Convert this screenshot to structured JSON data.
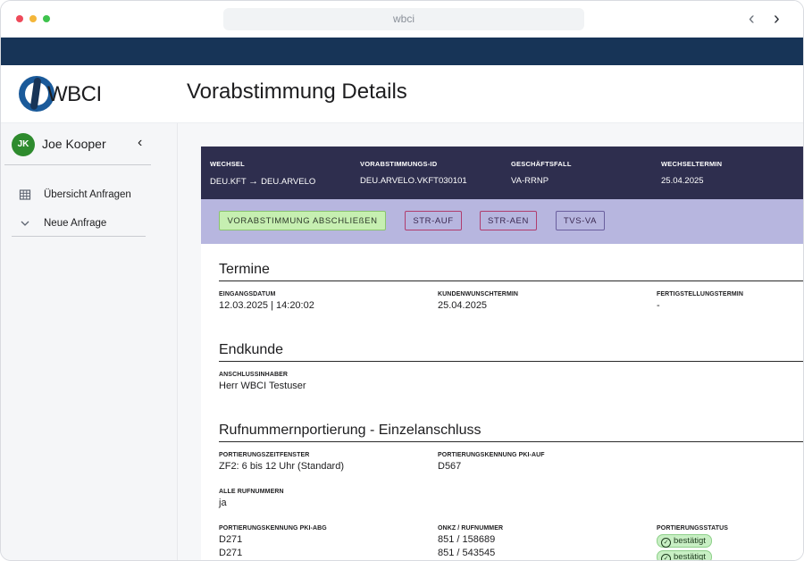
{
  "browser": {
    "url": "wbci"
  },
  "header": {
    "logo_text": "WBCI",
    "title": "Vorabstimmung Details"
  },
  "sidebar": {
    "user": {
      "initials": "JK",
      "name": "Joe Kooper"
    },
    "items": [
      {
        "label": "Übersicht Anfragen",
        "icon": "table-icon"
      },
      {
        "label": "Neue Anfrage",
        "icon": "chevron-down-icon"
      }
    ]
  },
  "summary": {
    "wechsel": {
      "label": "WECHSEL",
      "from": "DEU.KFT",
      "to": "DEU.ARVELO"
    },
    "vorabstimmungs_id": {
      "label": "VORABSTIMMUNGS-ID",
      "value": "DEU.ARVELO.VKFT030101"
    },
    "geschaeftsfall": {
      "label": "GESCHÄFTSFALL",
      "value": "VA-RRNP"
    },
    "wechseltermin": {
      "label": "WECHSELTERMIN",
      "value": "25.04.2025"
    }
  },
  "actions": {
    "primary": "VORABSTIMMUNG ABSCHLIEßEN",
    "str_auf": "STR-AUF",
    "str_aen": "STR-AEN",
    "tvs_va": "TVS-VA"
  },
  "termine": {
    "title": "Termine",
    "eingangsdatum": {
      "label": "EINGANGSDATUM",
      "value": "12.03.2025 | 14:20:02"
    },
    "kundenwunschtermin": {
      "label": "KUNDENWUNSCHTERMIN",
      "value": "25.04.2025"
    },
    "fertigstellungstermin": {
      "label": "FERTIGSTELLUNGSTERMIN",
      "value": "-"
    }
  },
  "endkunde": {
    "title": "Endkunde",
    "anschlussinhaber": {
      "label": "ANSCHLUSSINHABER",
      "value": "Herr WBCI Testuser"
    }
  },
  "rufnummer": {
    "title": "Rufnummernportierung - Einzelanschluss",
    "zeitfenster": {
      "label": "PORTIERUNGSZEITFENSTER",
      "value": "ZF2: 6 bis 12 Uhr (Standard)"
    },
    "pki_auf": {
      "label": "PORTIERUNGSKENNUNG PKI-AUF",
      "value": "D567"
    },
    "alle": {
      "label": "ALLE RUFNUMMERN",
      "value": "ja"
    },
    "pki_abg": {
      "label": "PORTIERUNGSKENNUNG PKI-ABG",
      "values": [
        "D271",
        "D271"
      ]
    },
    "onkz": {
      "label": "ONKZ / RUFNUMMER",
      "values": [
        "851 / 158689",
        "851 / 543545"
      ]
    },
    "status": {
      "label": "PORTIERUNGSSTATUS",
      "values": [
        "bestätigt",
        "bestätigt"
      ]
    }
  },
  "colors": {
    "navy": "#173457",
    "summary_bg": "#2e2e4e",
    "action_bg": "#b7b6df",
    "primary_btn": "#c6efb1",
    "status_badge": "#c8efc4"
  }
}
